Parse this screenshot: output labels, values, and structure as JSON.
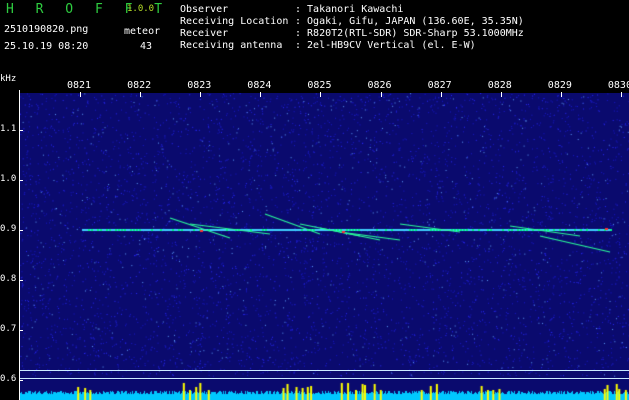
{
  "header": {
    "brand": "H R O F F T",
    "version": "1.0.0",
    "filename": "2510190820.png",
    "datetime": "25.10.19 08:20",
    "meteor_label": "meteor",
    "meteor_count": "43",
    "info": [
      {
        "key": "Observer",
        "value": ": Takanori Kawachi"
      },
      {
        "key": "Receiving Location",
        "value": ": Ogaki, Gifu, JAPAN (136.60E, 35.35N)"
      },
      {
        "key": "Receiver",
        "value": ": R820T2(RTL-SDR) SDR-Sharp 53.1000MHz"
      },
      {
        "key": "Receiving antenna",
        "value": ": 2el-HB9CV Vertical (el. E-W)"
      }
    ]
  },
  "chart_data": {
    "type": "heatmap",
    "y_unit": "kHz",
    "x_ticks": [
      "0821",
      "0822",
      "0823",
      "0824",
      "0825",
      "0826",
      "0827",
      "0828",
      "0829",
      "0830"
    ],
    "y_ticks": [
      "1.1",
      "1.0",
      "0.9",
      "0.8",
      "0.7",
      "0.6"
    ],
    "carrier_khz": 0.9,
    "colors": {
      "background": "#0a0a6e",
      "noise": "#2a2aff",
      "signal": "#00ff88",
      "hot": "#ff3030",
      "bar": "#00c8ff",
      "bar_hot": "#ffff00"
    }
  }
}
